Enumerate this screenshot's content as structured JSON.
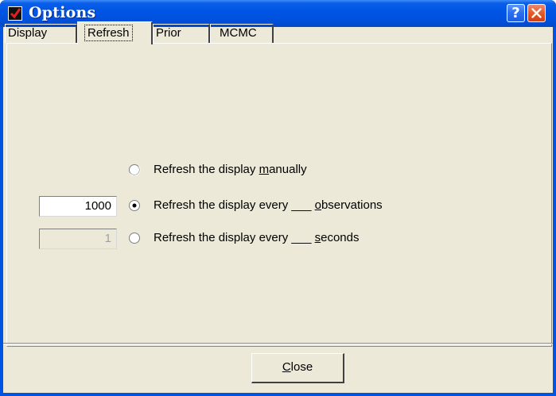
{
  "window": {
    "title": "Options",
    "help_button_label": "?"
  },
  "tabs": [
    {
      "label": "Display"
    },
    {
      "label": "Refresh",
      "selected": true
    },
    {
      "label": "Prior"
    },
    {
      "label": "MCMC"
    }
  ],
  "refresh": {
    "options": [
      {
        "label_before": "Refresh the display ",
        "mnemonic": "m",
        "label_after": "anually",
        "checked": false
      },
      {
        "label_before": "Refresh the display every ___ ",
        "mnemonic": "o",
        "label_after": "bservations",
        "checked": true
      },
      {
        "label_before": "Refresh the display every ___ ",
        "mnemonic": "s",
        "label_after": "econds",
        "checked": false
      }
    ],
    "observations_value": "1000",
    "seconds_value": "1",
    "seconds_enabled": false
  },
  "footer": {
    "close_mnemonic": "C",
    "close_rest": "lose"
  },
  "colors": {
    "titlebar": "#0055e5",
    "dialog_bg": "#ece9d8",
    "close_button": "#e45a2c"
  },
  "icons": {
    "app": "checkbox-icon",
    "help": "help-icon",
    "close": "close-icon"
  }
}
